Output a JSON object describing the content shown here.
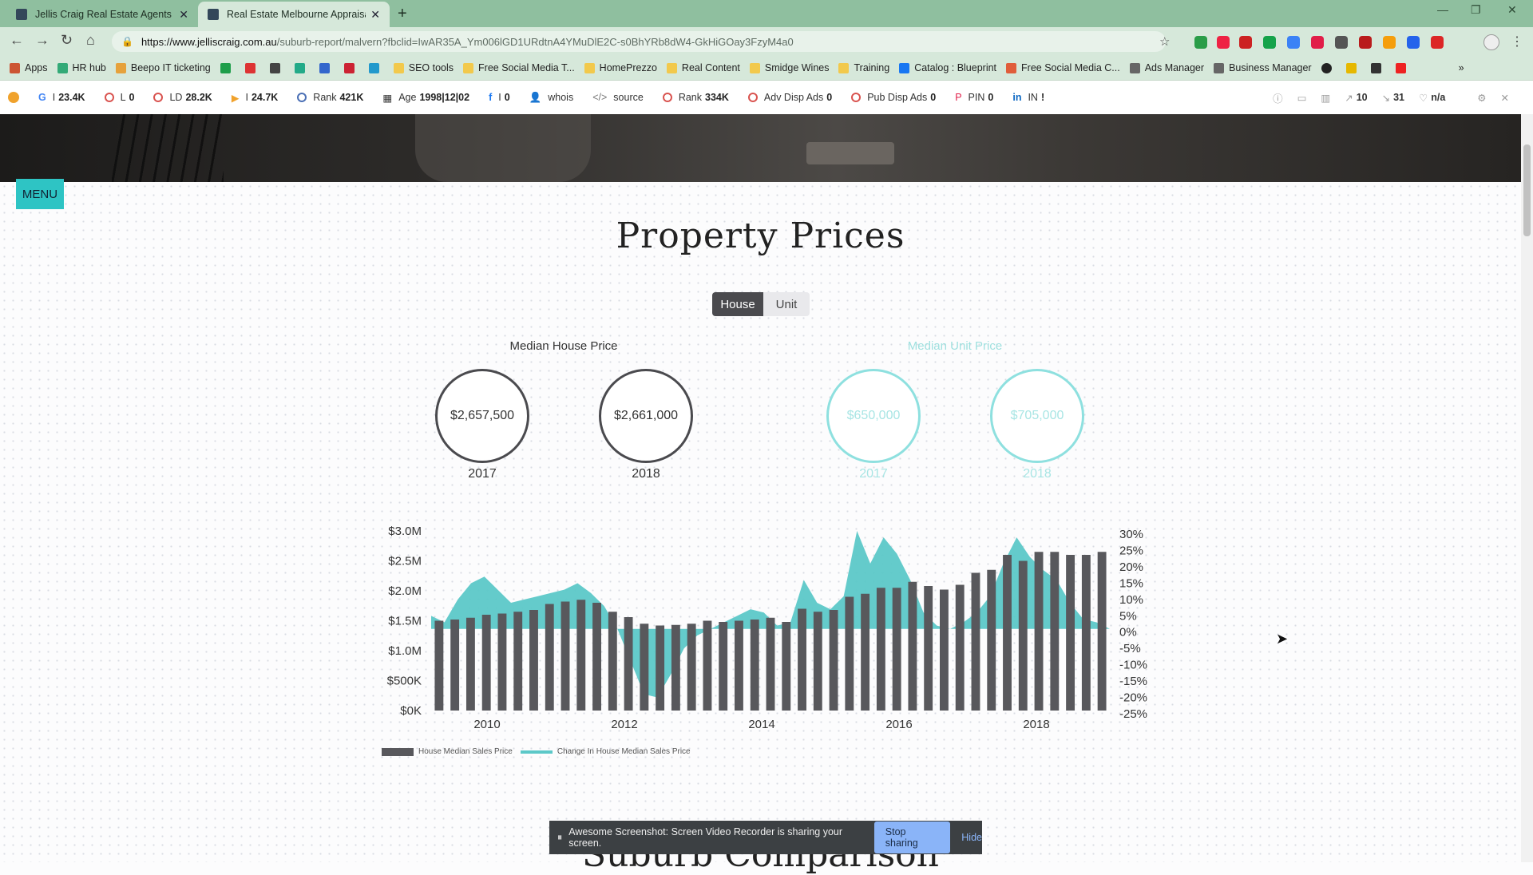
{
  "tabs": [
    {
      "title": "Jellis Craig Real Estate Agents &"
    },
    {
      "title": "Real Estate Melbourne Appraisal"
    }
  ],
  "url": {
    "host": "https://www.jelliscraig.com.au",
    "path": "/suburb-report/malvern?fbclid=IwAR35A_Ym006lGD1URdtnA4YMuDlE2C-s0BhYRb8dW4-GkHiGOay3FzyM4a0"
  },
  "bookmarks": [
    "Apps",
    "HR hub",
    "Beepo IT ticketing",
    "SEO tools",
    "Free Social Media T...",
    "HomePrezzo",
    "Real Content",
    "Smidge Wines",
    "Training",
    "Catalog : Blueprint",
    "Free Social Media C...",
    "Ads Manager",
    "Business Manager"
  ],
  "seo": [
    {
      "label": "I",
      "value": "23.4K"
    },
    {
      "label": "L",
      "value": "0"
    },
    {
      "label": "LD",
      "value": "28.2K"
    },
    {
      "label": "I",
      "value": "24.7K"
    },
    {
      "label": "Rank",
      "value": "421K"
    },
    {
      "label": "Age",
      "value": "1998|12|02"
    },
    {
      "label": "I",
      "value": "0"
    },
    {
      "label": "whois",
      "value": ""
    },
    {
      "label": "source",
      "value": ""
    },
    {
      "label": "Rank",
      "value": "334K"
    },
    {
      "label": "Adv Disp Ads",
      "value": "0"
    },
    {
      "label": "Pub Disp Ads",
      "value": "0"
    },
    {
      "label": "PIN",
      "value": "0"
    },
    {
      "label": "IN",
      "value": "!"
    }
  ],
  "seo_right": {
    "links": "10",
    "count": "31",
    "na": "n/a"
  },
  "page": {
    "menu": "MENU",
    "title": "Property Prices",
    "toggle": {
      "house": "House",
      "unit": "Unit"
    },
    "median_house_label": "Median House Price",
    "median_unit_label": "Median Unit Price",
    "house": [
      {
        "price": "$2,657,500",
        "year": "2017"
      },
      {
        "price": "$2,661,000",
        "year": "2018"
      }
    ],
    "unit": [
      {
        "price": "$650,000",
        "year": "2017"
      },
      {
        "price": "$705,000",
        "year": "2018"
      }
    ],
    "next_title": "Suburb Comparison"
  },
  "share_bar": {
    "text": "Awesome Screenshot: Screen Video Recorder is sharing your screen.",
    "stop": "Stop sharing",
    "hide": "Hide"
  },
  "colors": {
    "accent": "#2ec4c4",
    "bar": "#58585c",
    "area": "#5cc8c8"
  },
  "chart_data": {
    "type": "bar",
    "title": "",
    "x_tick_labels": [
      "2010",
      "2012",
      "2014",
      "2016",
      "2018"
    ],
    "y_left_ticks": [
      "$3.0M",
      "$2.5M",
      "$2.0M",
      "$1.5M",
      "$1.0M",
      "$500K",
      "$0K"
    ],
    "y_right_ticks": [
      "30%",
      "25%",
      "20%",
      "15%",
      "10%",
      "5%",
      "0%",
      "-5%",
      "-10%",
      "-15%",
      "-20%",
      "-25%"
    ],
    "ylim_left": [
      0,
      3000000
    ],
    "ylim_right": [
      -25,
      30
    ],
    "series": [
      {
        "name": "House Median Sales Price",
        "type": "bar",
        "values": [
          1500000,
          1520000,
          1550000,
          1600000,
          1620000,
          1650000,
          1680000,
          1780000,
          1820000,
          1850000,
          1800000,
          1650000,
          1560000,
          1450000,
          1420000,
          1430000,
          1450000,
          1500000,
          1480000,
          1500000,
          1520000,
          1550000,
          1480000,
          1700000,
          1650000,
          1680000,
          1900000,
          1950000,
          2050000,
          2050000,
          2150000,
          2080000,
          2020000,
          2100000,
          2300000,
          2350000,
          2600000,
          2500000,
          2650000,
          2650000,
          2600000,
          2600000,
          2650000
        ]
      },
      {
        "name": "Change In House Median Sales Price",
        "type": "area",
        "values": [
          4,
          2,
          9,
          14,
          16,
          12,
          8,
          9,
          10,
          11,
          12,
          14,
          11,
          7,
          0,
          -10,
          -20,
          -21,
          -14,
          -6,
          -2,
          0,
          2,
          4,
          6,
          5,
          1,
          2,
          15,
          8,
          6,
          10,
          30,
          20,
          28,
          23,
          15,
          5,
          1,
          0,
          2,
          5,
          10,
          20,
          28,
          22,
          18,
          15,
          8,
          3,
          2,
          0
        ]
      }
    ]
  }
}
